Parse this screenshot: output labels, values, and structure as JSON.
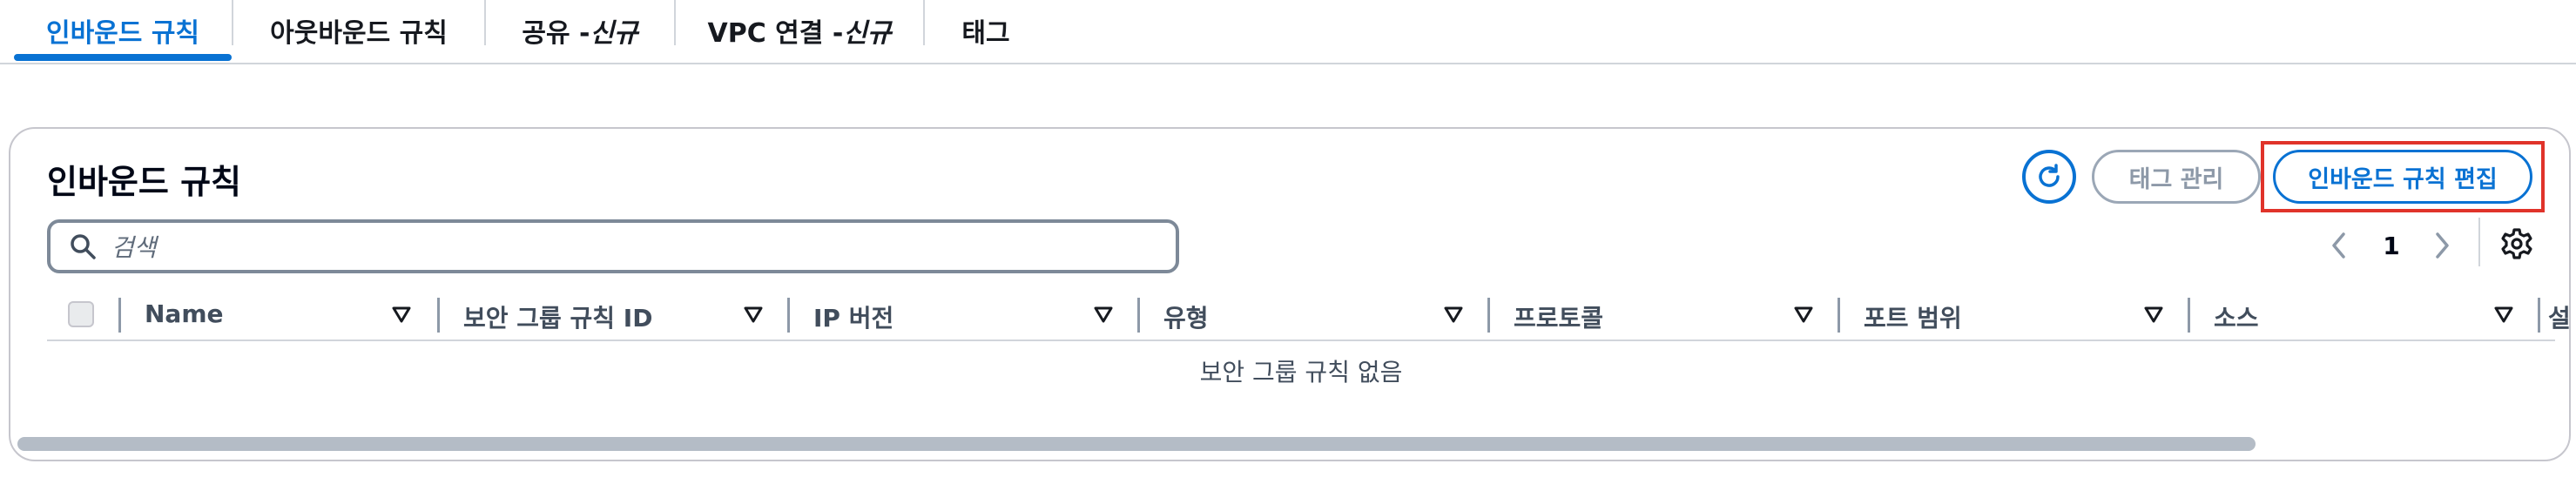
{
  "tabs": [
    {
      "label": "인바운드 규칙",
      "active": true
    },
    {
      "label": "아웃바운드 규칙",
      "active": false
    },
    {
      "label_main": "공유 -",
      "label_italic": "신규",
      "active": false
    },
    {
      "label_main": "VPC 연결 -",
      "label_italic": "신규",
      "active": false
    },
    {
      "label": "태그",
      "active": false
    }
  ],
  "panel": {
    "title": "인바운드 규칙",
    "refresh_icon": "refresh-icon",
    "manage_tags_label": "태그 관리",
    "edit_rules_label": "인바운드 규칙 편집",
    "search_placeholder": "검색",
    "pagination": {
      "current_page": "1"
    },
    "settings_icon": "gear-icon"
  },
  "table": {
    "columns": [
      "Name",
      "보안 그룹 규칙 ID",
      "IP 버전",
      "유형",
      "프로토콜",
      "포트 범위",
      "소스"
    ],
    "partial_column_char": "설",
    "empty_message": "보안 그룹 규칙 없음"
  },
  "colors": {
    "accent": "#0972d3",
    "disabled": "#8d99a8",
    "highlight": "#e0332a"
  }
}
